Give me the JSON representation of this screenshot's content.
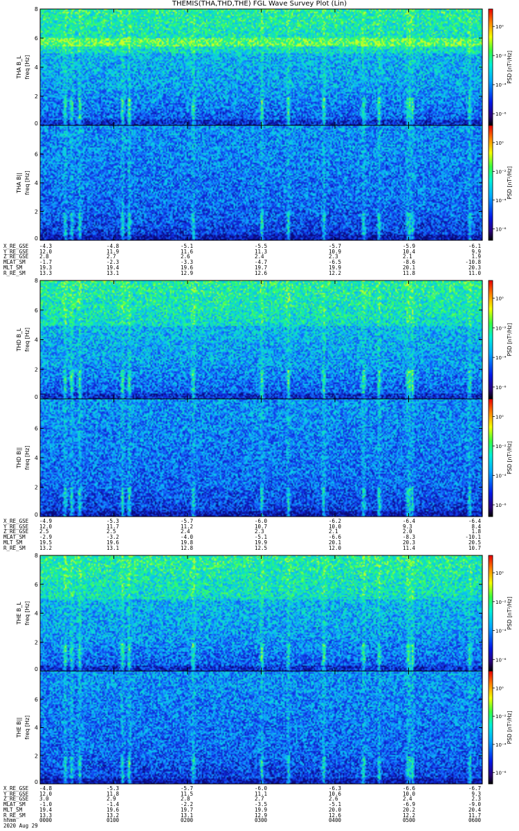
{
  "title": "THEMIS(THA,THD,THE) FGL Wave Survey Plot (Lin)",
  "date": "2020 Aug 29",
  "colorbar": {
    "label": "PSD [nT²/Hz]",
    "ticks": [
      "10⁰",
      "10⁻²",
      "10⁻⁴",
      "10⁻⁶"
    ]
  },
  "colors": {
    "background_spectrogram": "#1a3cd8",
    "low_level": "#0a14a0",
    "mid_level": "#10b4e0",
    "high_level": "#14e8a0"
  },
  "chart_data": [
    {
      "type": "heatmap",
      "panel": "THA B_L",
      "probe": "THA",
      "ylabel": "THA B_L freq [Hz]",
      "yticks": [
        "0",
        "2",
        "4",
        "6",
        "8"
      ],
      "ylim": [
        0,
        8
      ],
      "xlim": [
        "0000",
        "0600"
      ],
      "zscale": "log",
      "zlim": [
        1e-07,
        10.0
      ]
    },
    {
      "type": "heatmap",
      "panel": "THA B||",
      "probe": "THA",
      "ylabel": "THA B|| freq [Hz]",
      "yticks": [
        "0",
        "2",
        "4",
        "6"
      ],
      "ylim": [
        0,
        8
      ],
      "xlim": [
        "0000",
        "0600"
      ],
      "zscale": "log",
      "zlim": [
        1e-07,
        10.0
      ]
    },
    {
      "type": "heatmap",
      "panel": "THD B_L",
      "probe": "THD",
      "ylabel": "THD B_L freq [Hz]",
      "yticks": [
        "0",
        "2",
        "4",
        "6",
        "8"
      ],
      "ylim": [
        0,
        8
      ],
      "xlim": [
        "0000",
        "0600"
      ],
      "zscale": "log",
      "zlim": [
        1e-07,
        10.0
      ]
    },
    {
      "type": "heatmap",
      "panel": "THD B||",
      "probe": "THD",
      "ylabel": "THD B|| freq [Hz]",
      "yticks": [
        "0",
        "2",
        "4",
        "6"
      ],
      "ylim": [
        0,
        8
      ],
      "xlim": [
        "0000",
        "0600"
      ],
      "zscale": "log",
      "zlim": [
        1e-07,
        10.0
      ]
    },
    {
      "type": "heatmap",
      "panel": "THE B_L",
      "probe": "THE",
      "ylabel": "THE B_L freq [Hz]",
      "yticks": [
        "0",
        "2",
        "4",
        "6",
        "8"
      ],
      "ylim": [
        0,
        8
      ],
      "xlim": [
        "0000",
        "0600"
      ],
      "zscale": "log",
      "zlim": [
        1e-07,
        10.0
      ]
    },
    {
      "type": "heatmap",
      "panel": "THE B||",
      "probe": "THE",
      "ylabel": "THE B|| freq [Hz]",
      "yticks": [
        "0",
        "2",
        "4",
        "6"
      ],
      "ylim": [
        0,
        8
      ],
      "xlim": [
        "0000",
        "0600"
      ],
      "zscale": "log",
      "zlim": [
        1e-07,
        10.0
      ]
    }
  ],
  "ephemeris": [
    {
      "probe": "THA",
      "rows": [
        {
          "label": "X_RE_GSE",
          "values": [
            "-4.3",
            "-4.8",
            "-5.1",
            "-5.5",
            "-5.7",
            "-5.9",
            "-6.1"
          ]
        },
        {
          "label": "Y_RE_GSE",
          "values": [
            "12.0",
            "11.9",
            "11.6",
            "11.3",
            "10.9",
            "10.4",
            "9.9"
          ]
        },
        {
          "label": "Z_RE_GSE",
          "values": [
            "2.8",
            "2.7",
            "2.6",
            "2.4",
            "2.3",
            "2.1",
            "1.9"
          ]
        },
        {
          "label": "MLAT_SM",
          "values": [
            "-1.7",
            "-2.3",
            "-3.3",
            "-4.7",
            "-6.5",
            "-8.6",
            "-10.8"
          ]
        },
        {
          "label": "MLT_SM",
          "values": [
            "19.3",
            "19.4",
            "19.6",
            "19.7",
            "19.9",
            "20.1",
            "20.3"
          ]
        },
        {
          "label": "R_RE_SM",
          "values": [
            "13.3",
            "13.1",
            "12.9",
            "12.6",
            "12.2",
            "11.8",
            "11.0"
          ]
        }
      ]
    },
    {
      "probe": "THD",
      "rows": [
        {
          "label": "X_RE_GSE",
          "values": [
            "-4.9",
            "-5.3",
            "-5.7",
            "-6.0",
            "-6.2",
            "-6.4",
            "-6.4"
          ]
        },
        {
          "label": "Y_RE_GSE",
          "values": [
            "12.0",
            "11.7",
            "11.2",
            "10.7",
            "10.0",
            "9.3",
            "8.4"
          ]
        },
        {
          "label": "Z_RE_GSE",
          "values": [
            "2.5",
            "2.5",
            "2.4",
            "2.3",
            "2.1",
            "2.0",
            "1.8"
          ]
        },
        {
          "label": "MLAT_SM",
          "values": [
            "-2.9",
            "-3.2",
            "-4.0",
            "-5.1",
            "-6.6",
            "-8.3",
            "-10.1"
          ]
        },
        {
          "label": "MLT_SM",
          "values": [
            "19.5",
            "19.6",
            "19.8",
            "19.9",
            "20.1",
            "20.3",
            "20.5"
          ]
        },
        {
          "label": "R_RE_SM",
          "values": [
            "13.2",
            "13.1",
            "12.8",
            "12.5",
            "12.0",
            "11.4",
            "10.7"
          ]
        }
      ]
    },
    {
      "probe": "THE",
      "rows": [
        {
          "label": "X_RE_GSE",
          "values": [
            "-4.8",
            "-5.3",
            "-5.7",
            "-6.0",
            "-6.3",
            "-6.6",
            "-6.7"
          ]
        },
        {
          "label": "Y_RE_GSE",
          "values": [
            "12.0",
            "11.8",
            "11.5",
            "11.1",
            "10.6",
            "10.0",
            "9.3"
          ]
        },
        {
          "label": "Z_RE_GSE",
          "values": [
            "3.0",
            "2.9",
            "2.8",
            "2.7",
            "2.6",
            "2.4",
            "2.3"
          ]
        },
        {
          "label": "MLAT_SM",
          "values": [
            "-1.0",
            "-1.4",
            "-2.2",
            "-3.5",
            "-5.1",
            "-6.9",
            "-9.0"
          ]
        },
        {
          "label": "MLT_SM",
          "values": [
            "19.4",
            "19.6",
            "19.7",
            "19.9",
            "20.0",
            "20.2",
            "20.4"
          ]
        },
        {
          "label": "R_RE_SM",
          "values": [
            "13.3",
            "13.2",
            "13.1",
            "12.9",
            "12.6",
            "12.2",
            "11.7"
          ]
        },
        {
          "label": "hhmm",
          "values": [
            "0000",
            "0100",
            "0200",
            "0300",
            "0400",
            "0500",
            "0600"
          ]
        }
      ]
    }
  ]
}
